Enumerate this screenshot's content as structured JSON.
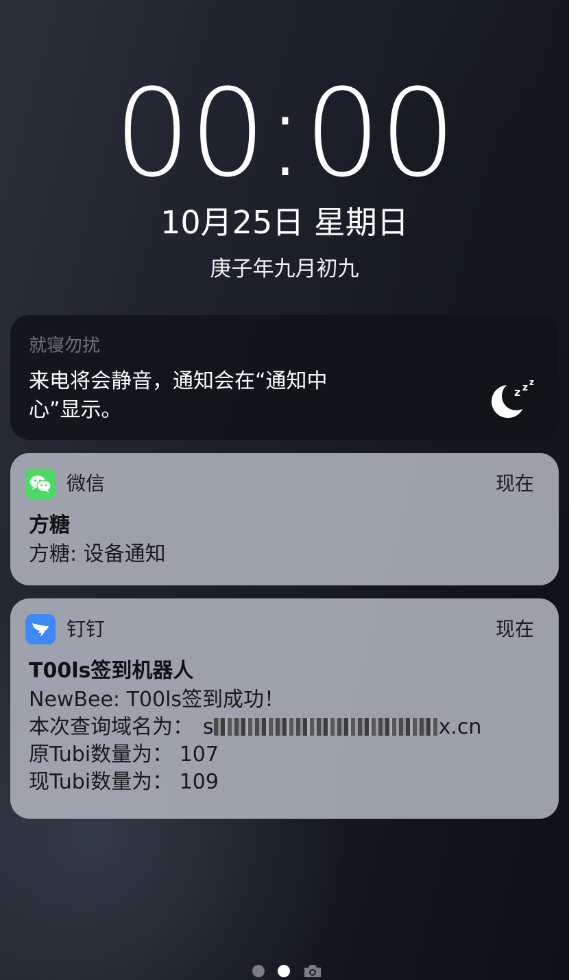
{
  "lock_screen": {
    "time": "00:00",
    "date": "10月25日 星期日",
    "lunar_date": "庚子年九月初九"
  },
  "do_not_disturb": {
    "title": "就寝勿扰",
    "body_line1": "来电将会静音，通知会在“通知中",
    "body_line2": "心”显示。",
    "icon": "moon-zzz-icon"
  },
  "notifications": [
    {
      "app": "微信",
      "icon": "wechat-icon",
      "accent": "#4cd964",
      "time": "现在",
      "title": "方糖",
      "body": "方糖: 设备通知"
    },
    {
      "app": "钉钉",
      "icon": "dingtalk-icon",
      "accent": "#3d8af7",
      "time": "现在",
      "title": "T00ls签到机器人",
      "lines": {
        "line1": "NewBee: T00ls签到成功！",
        "domain_label": "本次查询域名为：",
        "domain_prefix": "s",
        "domain_suffix": "x.cn",
        "line3": "原Tubi数量为： 107",
        "line4": "现Tubi数量为： 109"
      }
    }
  ],
  "page_indicators": {
    "count": 2,
    "active_index": 1,
    "trailing_icon": "camera-icon"
  }
}
